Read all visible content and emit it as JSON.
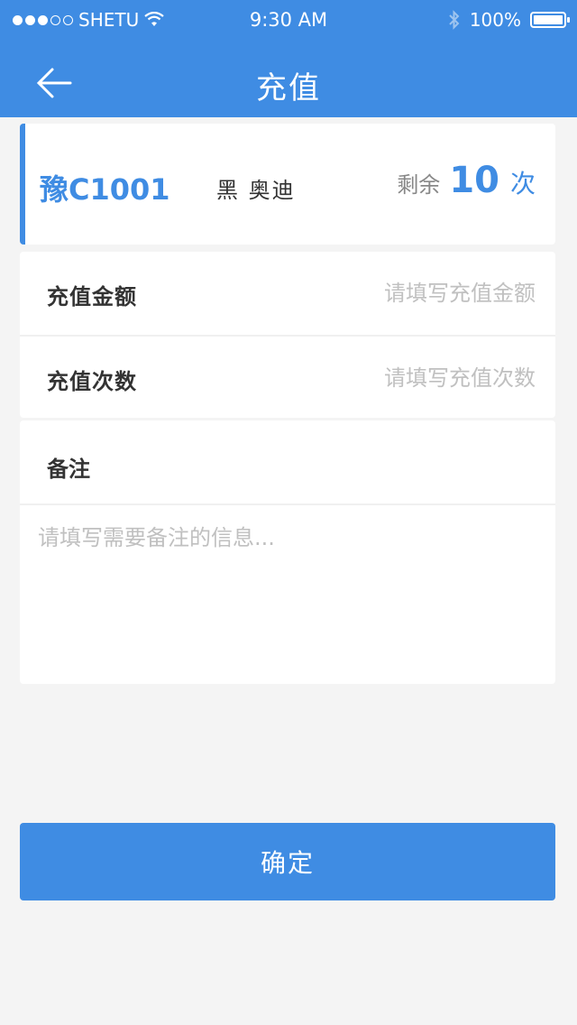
{
  "status_bar": {
    "carrier": "SHETU",
    "time": "9:30 AM",
    "battery": "100%",
    "icons": [
      "signal-dots-icon",
      "wifi-icon",
      "bluetooth-icon",
      "battery-icon"
    ]
  },
  "nav": {
    "title": "充值",
    "back_icon": "back-arrow-icon"
  },
  "vehicle": {
    "plate": "豫C1001",
    "info": "黑 奥迪",
    "remain_label": "剩余",
    "remain_count": "10",
    "remain_unit": "次"
  },
  "form": {
    "amount": {
      "label": "充值金额",
      "value": "",
      "placeholder": "请填写充值金额"
    },
    "times": {
      "label": "充值次数",
      "value": "",
      "placeholder": "请填写充值次数"
    }
  },
  "remark": {
    "label": "备注",
    "value": "",
    "placeholder": "请填写需要备注的信息..."
  },
  "confirm_label": "确定",
  "colors": {
    "primary": "#3f8ce3",
    "background": "#f4f4f4",
    "placeholder": "#c0c0c0"
  }
}
